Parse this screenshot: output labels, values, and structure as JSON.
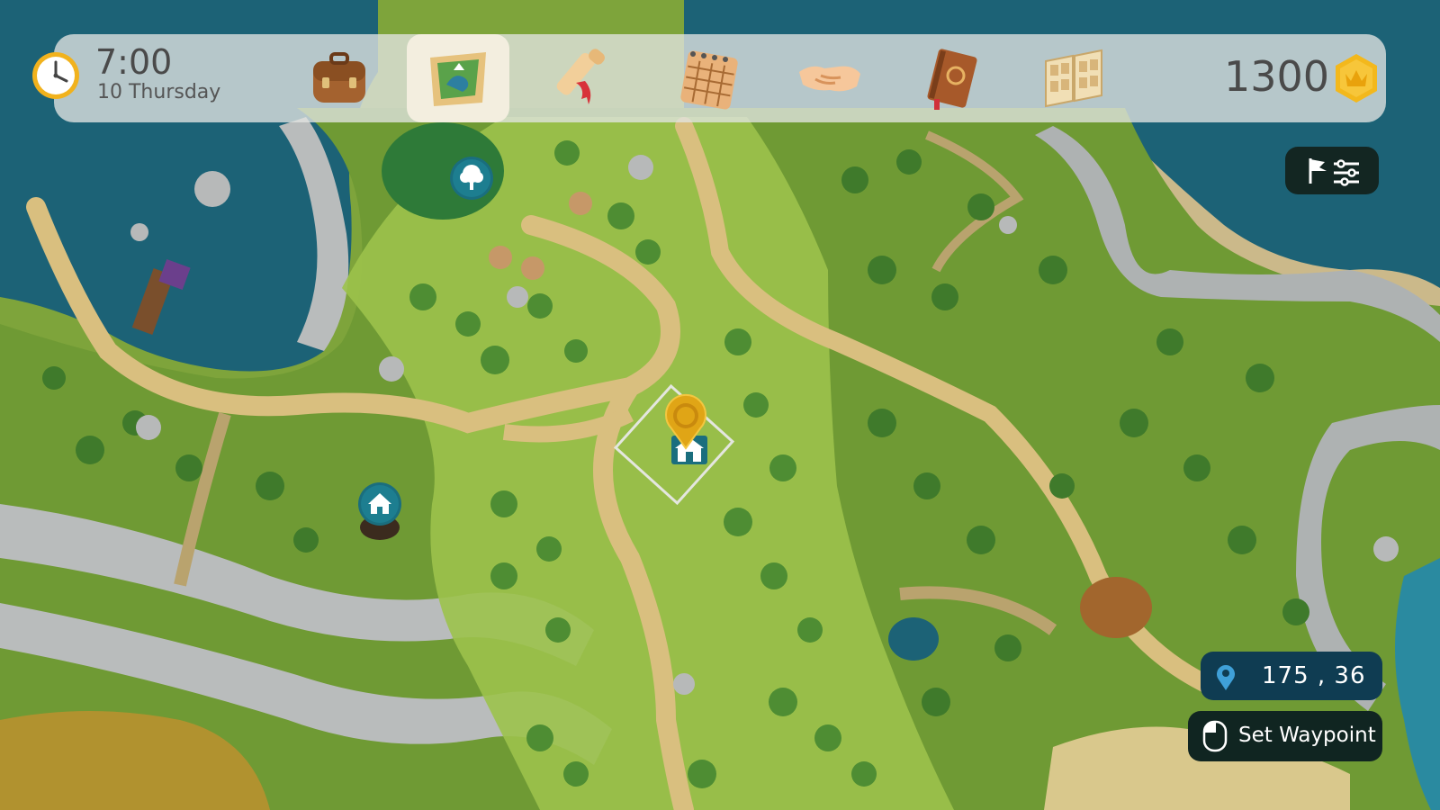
{
  "topbar": {
    "time": "7:00",
    "date": "10 Thursday",
    "coins": "1300",
    "tabs": [
      {
        "name": "inventory",
        "icon": "backpack-icon",
        "active": false
      },
      {
        "name": "map",
        "icon": "map-icon",
        "active": true
      },
      {
        "name": "quests",
        "icon": "scroll-icon",
        "active": false
      },
      {
        "name": "calendar",
        "icon": "calendar-icon",
        "active": false
      },
      {
        "name": "relationships",
        "icon": "handshake-icon",
        "active": false
      },
      {
        "name": "journal",
        "icon": "book-icon",
        "active": false
      },
      {
        "name": "collection",
        "icon": "album-icon",
        "active": false
      }
    ]
  },
  "map": {
    "markers": [
      {
        "type": "tree-marker-icon"
      },
      {
        "type": "house-marker-icon"
      },
      {
        "type": "player-marker-icon"
      },
      {
        "type": "home-building-icon"
      }
    ]
  },
  "coordinates": {
    "text": "175 , 36"
  },
  "actions": {
    "set_waypoint": "Set Waypoint",
    "filter_icon": "flag-filter-icon"
  },
  "colors": {
    "topbar_bg": "#e1e4e1",
    "active_tab_bg": "#f3eedf",
    "coin_gold": "#f3b81c",
    "water": "#1c6276",
    "grass": "#8fb443",
    "path": "#e6c27d",
    "coord_box_bg": "#0f3c52",
    "button_bg": "#102521"
  }
}
